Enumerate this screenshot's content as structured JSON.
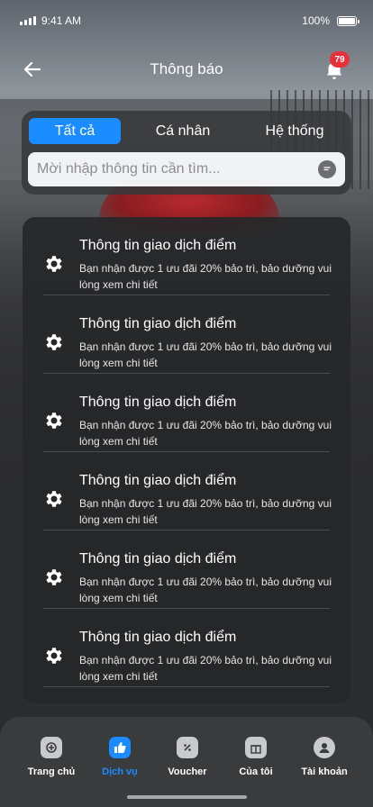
{
  "status_bar": {
    "time": "9:41 AM",
    "battery": "100%"
  },
  "header": {
    "title": "Thông báo",
    "badge_count": "79"
  },
  "tabs": [
    {
      "label": "Tất cả",
      "active": true
    },
    {
      "label": "Cá nhân",
      "active": false
    },
    {
      "label": "Hệ thống",
      "active": false
    }
  ],
  "search": {
    "placeholder": "Mời nhập thông tin cần tìm...",
    "value": ""
  },
  "notifications": [
    {
      "title": "Thông tin giao dịch điểm",
      "body": "Bạn nhận được 1 ưu đãi 20% bảo trì, bảo dưỡng vui lòng xem chi tiết",
      "icon": "gear-icon"
    },
    {
      "title": "Thông tin giao dịch điểm",
      "body": "Bạn nhận được 1 ưu đãi 20% bảo trì, bảo dưỡng vui lòng xem chi tiết",
      "icon": "gear-icon"
    },
    {
      "title": "Thông tin giao dịch điểm",
      "body": "Bạn nhận được 1 ưu đãi 20% bảo trì, bảo dưỡng vui lòng xem chi tiết",
      "icon": "gear-icon"
    },
    {
      "title": "Thông tin giao dịch điểm",
      "body": "Bạn nhận được 1 ưu đãi 20% bảo trì, bảo dưỡng vui lòng xem chi tiết",
      "icon": "gear-icon"
    },
    {
      "title": "Thông tin giao dịch điểm",
      "body": "Bạn nhận được 1 ưu đãi 20% bảo trì, bảo dưỡng vui lòng xem chi tiết",
      "icon": "gear-icon"
    },
    {
      "title": "Thông tin giao dịch điểm",
      "body": "Bạn nhận được 1 ưu đãi 20% bảo trì, bảo dưỡng vui lòng xem chi tiết",
      "icon": "gear-icon"
    }
  ],
  "bottom_nav": [
    {
      "label": "Trang chủ",
      "icon": "home-icon",
      "active": false
    },
    {
      "label": "Dịch vụ",
      "icon": "thumbs-up-icon",
      "active": true
    },
    {
      "label": "Voucher",
      "icon": "voucher-icon",
      "active": false
    },
    {
      "label": "Của tôi",
      "icon": "gift-icon",
      "active": false
    },
    {
      "label": "Tài khoản",
      "icon": "account-icon",
      "active": false
    }
  ],
  "colors": {
    "accent": "#1a8cff",
    "badge": "#e8303a"
  }
}
